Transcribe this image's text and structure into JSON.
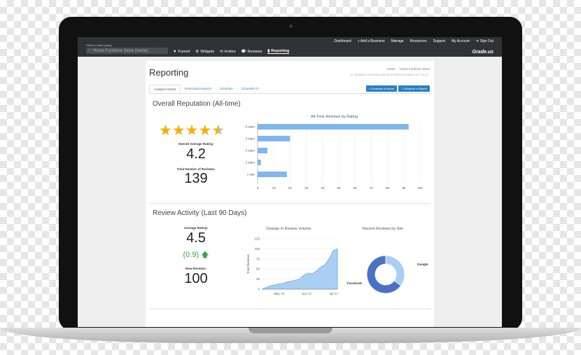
{
  "topbar": {
    "hint": "Select or start typing",
    "search_placeholder": "Home Furniture Store (home)",
    "links": [
      "Dashboard",
      "+ Add a Business",
      "Manage",
      "Resources",
      "Support",
      "My Account",
      "✕ Sign Out"
    ],
    "nav": [
      {
        "icon": "filter-icon",
        "glyph": "▼",
        "label": "Funnel"
      },
      {
        "icon": "gear-icon",
        "glyph": "⚙",
        "label": "Widgets"
      },
      {
        "icon": "envelope-icon",
        "glyph": "✉",
        "label": "Invites"
      },
      {
        "icon": "speech-bubble-icon",
        "glyph": "💬",
        "label": "Reviews"
      },
      {
        "icon": "bar-chart-icon",
        "glyph": "▮",
        "label": "Reporting"
      }
    ],
    "logo": "Grade.us"
  },
  "page": {
    "title": "Reporting",
    "breadcrumb_home": "Home",
    "breadcrumb_current": "Home Furniture Store",
    "breadcrumb_sub": "ID: 3fb9ae6e-266f-4b6f-a4d2-8f1d2a56f4f3 created 2017-04-10",
    "tabs": [
      "Analytics Detail",
      "Generated Reports",
      "Schedule",
      "Schedule #2"
    ],
    "buttons": [
      "+ Generate a Report",
      "+ Schedule a Report"
    ]
  },
  "reputation": {
    "heading": "Overall Reputation (All-time)",
    "avg_label": "Overall Average Rating:",
    "avg_value": "4.2",
    "total_label": "Total Number of Reviews:",
    "total_value": "139",
    "star_rating": 4.2
  },
  "activity": {
    "heading": "Review Activity (Last 90 Days)",
    "avg_label": "Average Rating:",
    "avg_value": "4.5",
    "change_value": "(0.9)",
    "new_label": "New Reviews:",
    "new_value": "100"
  },
  "colors": {
    "accent": "#2a7fc6",
    "bar": "#80b6ec",
    "area": "#a9cff3",
    "star": "#f4b000",
    "positive": "#3aa040",
    "donut_facebook": "#4a72c4",
    "donut_google": "#a9cff3"
  },
  "chart_data": [
    {
      "type": "bar",
      "orientation": "horizontal",
      "title": "All-Time Reviews by Rating",
      "categories": [
        "5 stars",
        "4 stars",
        "3 stars",
        "2 stars",
        "1 star"
      ],
      "values": [
        93,
        20,
        6,
        2,
        18
      ],
      "xlim": [
        0,
        100
      ],
      "xticks": [
        0,
        10,
        20,
        30,
        40,
        50,
        60,
        70,
        80,
        90,
        100
      ],
      "grid": true
    },
    {
      "type": "area",
      "title": "Change in Review Volume",
      "ylabel": "Total Reviews",
      "ylim": [
        0,
        125
      ],
      "yticks": [
        0,
        25,
        50,
        75,
        100,
        125
      ],
      "xticklabels": [
        "May '17",
        "Jun '17",
        "Jul '17"
      ],
      "x": [
        0,
        5,
        10,
        15,
        20,
        25,
        30,
        35,
        40,
        45,
        50,
        55,
        60,
        65,
        70,
        75,
        80,
        85,
        90
      ],
      "values": [
        0,
        4,
        8,
        10,
        13,
        14,
        18,
        20,
        22,
        25,
        35,
        40,
        38,
        45,
        55,
        60,
        75,
        95,
        100
      ]
    },
    {
      "type": "pie",
      "title": "Recent Reviews by Site",
      "donut": true,
      "labels": [
        "Facebook",
        "Google"
      ],
      "values": [
        65,
        35
      ]
    }
  ]
}
